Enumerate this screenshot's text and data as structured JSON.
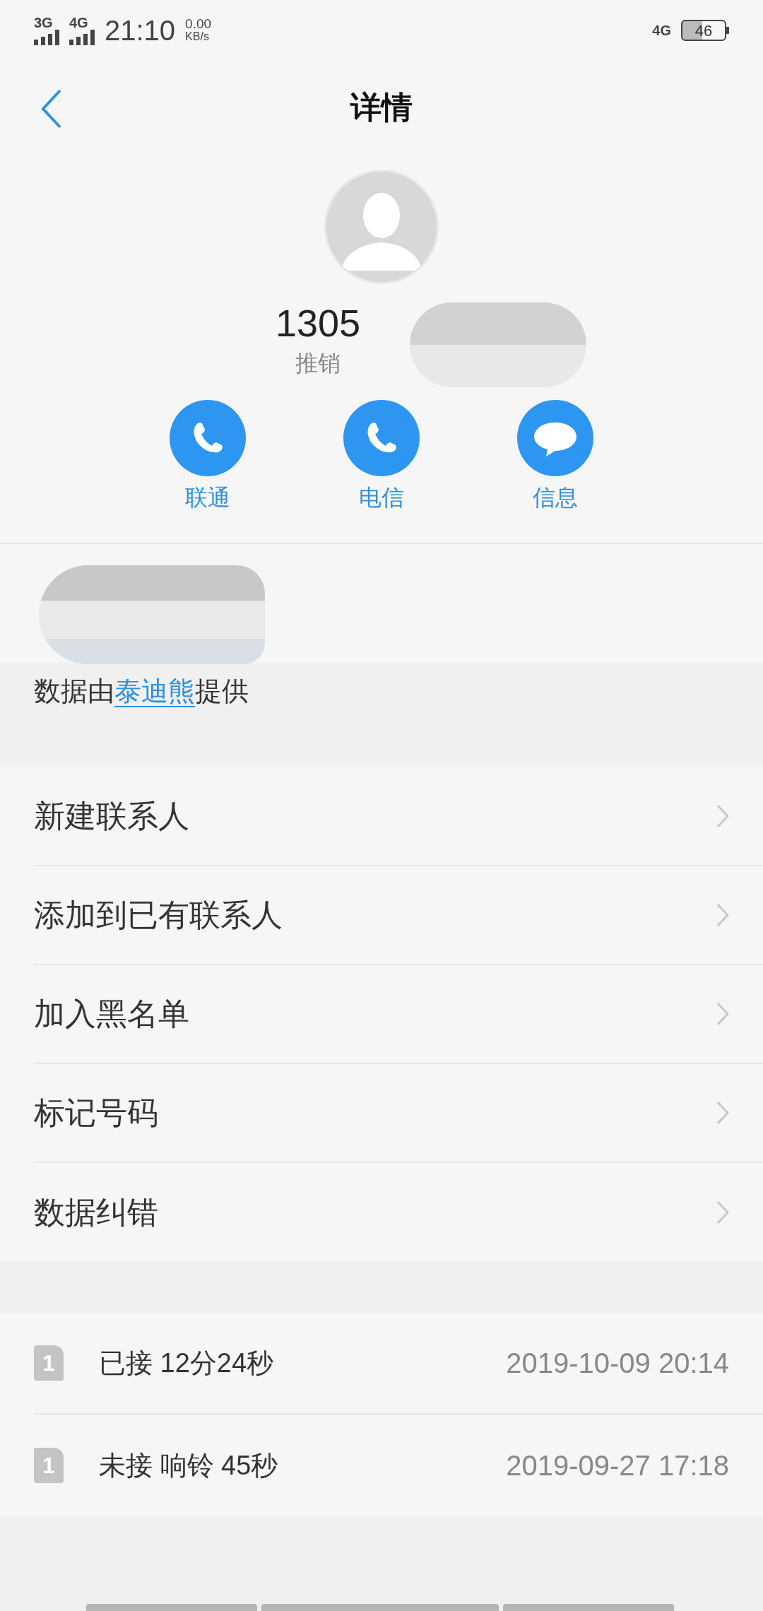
{
  "status_bar": {
    "sim_labels": [
      "3G",
      "4G"
    ],
    "time": "21:10",
    "speed_value": "0.00",
    "speed_unit": "KB/s",
    "network": "4G",
    "battery": "46"
  },
  "header": {
    "title": "详情"
  },
  "contact": {
    "number": "1305",
    "tag": "推销"
  },
  "actions": [
    {
      "kind": "call",
      "label": "联通"
    },
    {
      "kind": "call",
      "label": "电信"
    },
    {
      "kind": "message",
      "label": "信息"
    }
  ],
  "source": {
    "prefix": "数据由",
    "link": "泰迪熊",
    "suffix": "提供"
  },
  "menu": [
    {
      "label": "新建联系人"
    },
    {
      "label": "添加到已有联系人"
    },
    {
      "label": "加入黑名单"
    },
    {
      "label": "标记号码"
    },
    {
      "label": "数据纠错"
    }
  ],
  "call_log": [
    {
      "sim": "1",
      "detail": "已接 12分24秒",
      "time": "2019-10-09 20:14"
    },
    {
      "sim": "1",
      "detail": "未接 响铃 45秒",
      "time": "2019-09-27 17:18"
    }
  ]
}
